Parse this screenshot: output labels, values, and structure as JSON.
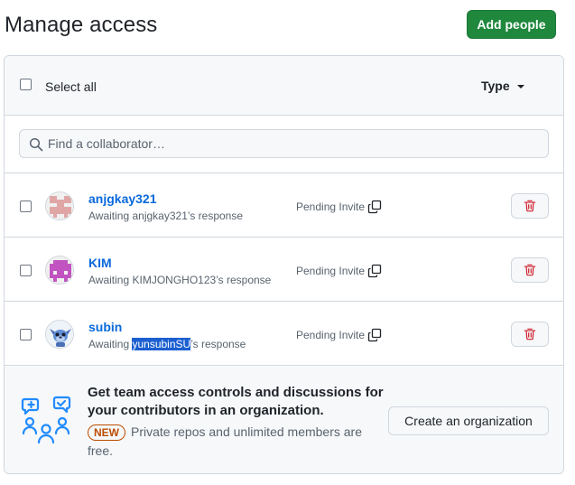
{
  "header": {
    "title": "Manage access",
    "add_button_label": "Add people",
    "add_button_color": "#1f883d"
  },
  "list_header": {
    "select_all_label": "Select all",
    "type_filter_label": "Type"
  },
  "search": {
    "placeholder": "Find a collaborator…",
    "value": ""
  },
  "collaborators": [
    {
      "name": "anjgkay321",
      "status_prefix": "Awaiting ",
      "status_user": "anjgkay321",
      "status_suffix": "’s response",
      "invite_status": "Pending Invite",
      "avatar_color": "#e0a6a6",
      "highlighted": false
    },
    {
      "name": "KIM",
      "status_prefix": "Awaiting ",
      "status_user": "KIMJONGHO123",
      "status_suffix": "’s response",
      "invite_status": "Pending Invite",
      "avatar_color": "#c154c1",
      "highlighted": false
    },
    {
      "name": "subin",
      "status_prefix": "Awaiting ",
      "status_user": "yunsubinSU",
      "status_suffix": "’s response",
      "invite_status": "Pending Invite",
      "avatar_color": "#5f8fd6",
      "highlighted": true
    }
  ],
  "promo": {
    "title": "Get team access controls and discussions for your contributors in an organization.",
    "badge": "NEW",
    "description": "Private repos and unlimited members are free.",
    "button_label": "Create an organization"
  },
  "colors": {
    "link": "#0969da",
    "danger": "#cf222e",
    "badge": "#bc4c00",
    "selection": "#1c5fd1"
  },
  "icons": [
    "search-icon",
    "copy-icon",
    "trash-icon",
    "team-discussion-illustration"
  ]
}
